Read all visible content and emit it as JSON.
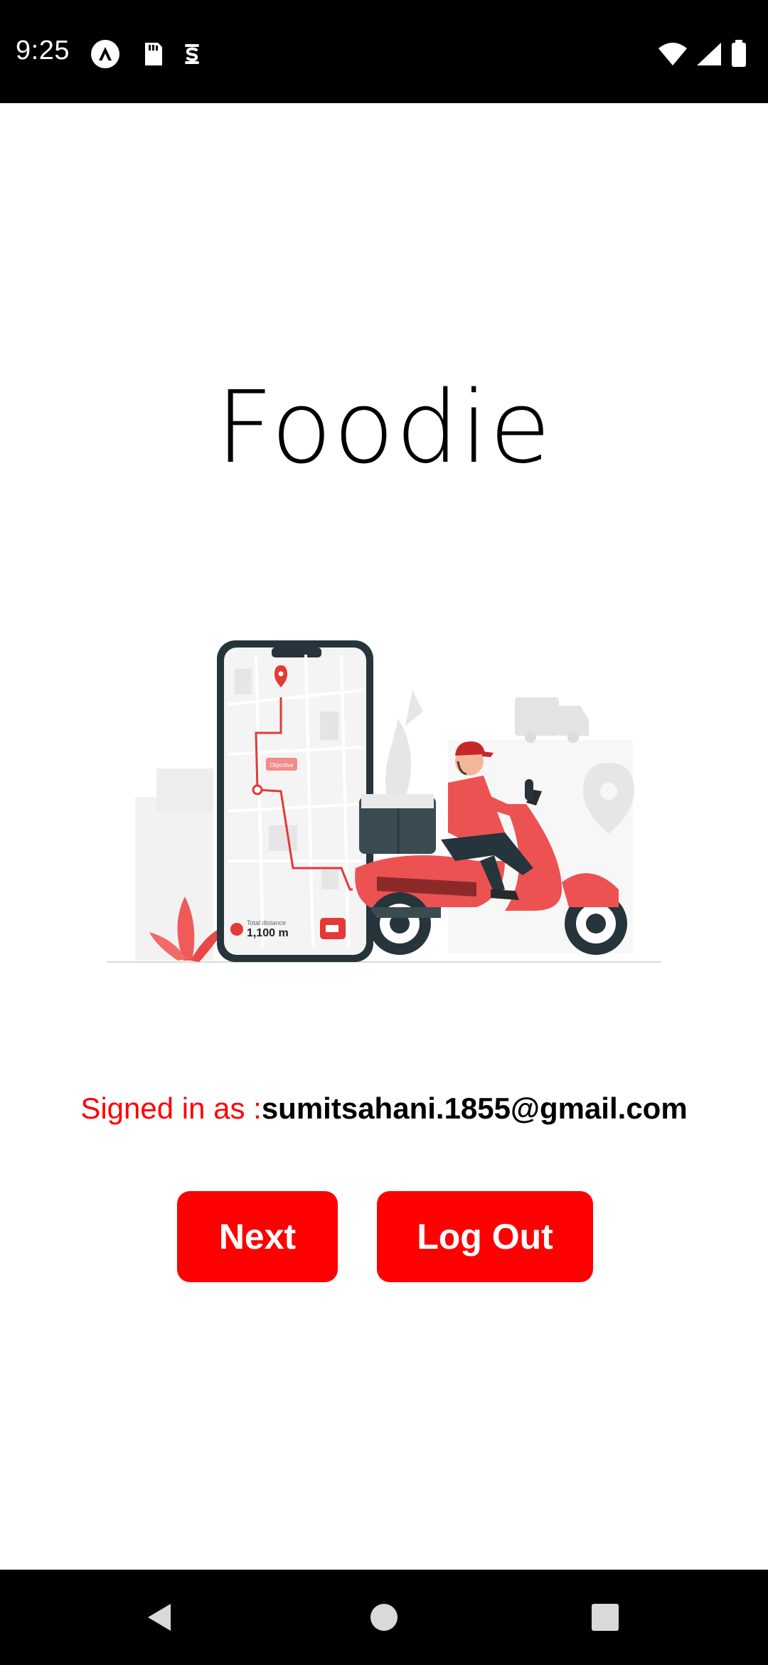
{
  "status_bar": {
    "time": "9:25",
    "left_icons": [
      "autofill-icon",
      "sd-card-icon",
      "sync-app-icon"
    ],
    "right_icons": [
      "wifi-icon",
      "cell-signal-icon",
      "battery-icon"
    ]
  },
  "app": {
    "title": "Foodie"
  },
  "illustration": {
    "icon": "delivery-scooter-illustration",
    "map_tag": "Objective",
    "distance_label": "Total distance",
    "distance_value": "1,100 m"
  },
  "account": {
    "signed_in_label": "Signed in as :",
    "email": "sumitsahani.1855@gmail.com"
  },
  "actions": {
    "next_label": "Next",
    "logout_label": "Log Out"
  },
  "nav_bar": {
    "icons": [
      "back-icon",
      "home-icon",
      "recents-icon"
    ]
  },
  "colors": {
    "accent": "#ff0000",
    "status_bar": "#000000",
    "background": "#ffffff"
  }
}
